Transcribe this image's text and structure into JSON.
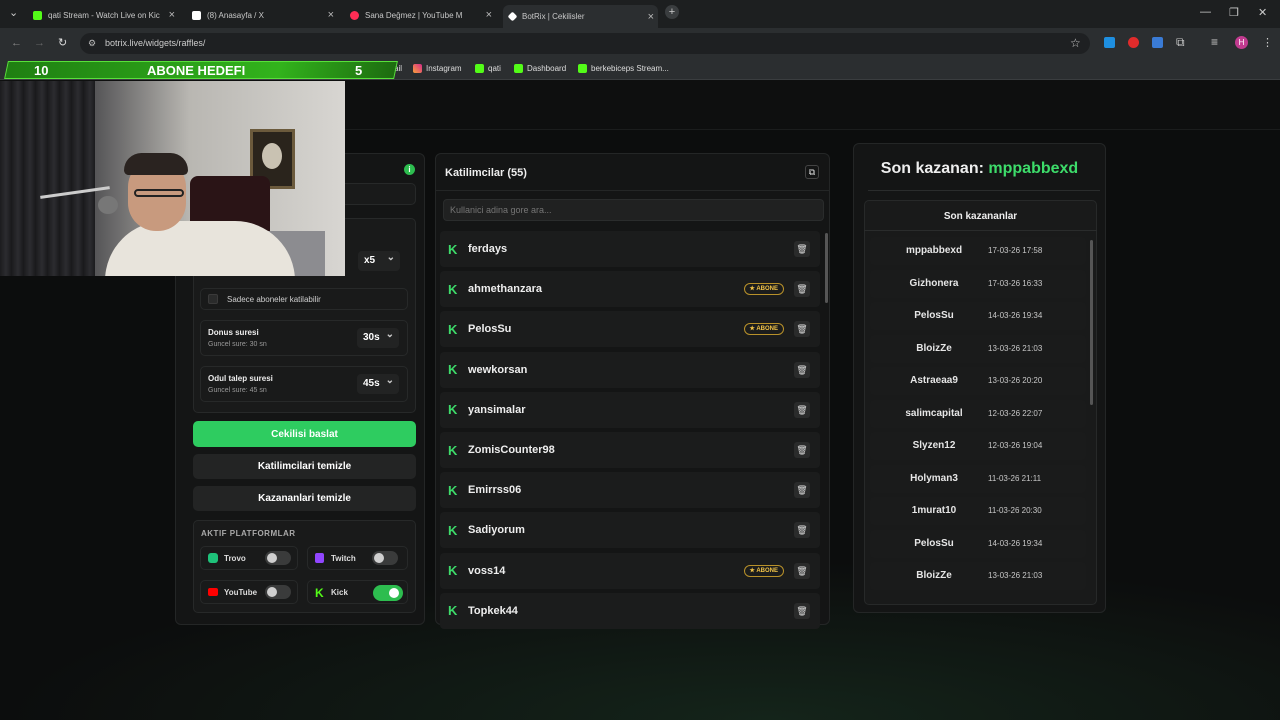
{
  "browser": {
    "tabs": [
      {
        "title": "qati Stream - Watch Live on Kic",
        "color": "#53fc18"
      },
      {
        "title": "(8) Anasayfa / X",
        "color": "#ffffff"
      },
      {
        "title": "Sana Değmez | YouTube M",
        "color": "#ff2d55"
      },
      {
        "title": "BotRix | Cekilisler",
        "color": "#ffffff"
      }
    ],
    "url": "botrix.live/widgets/raffles/",
    "bookmarks": [
      "Instagram",
      "qati",
      "Dashboard",
      "berkebiceps Stream..."
    ],
    "bookmark_partial": "ail"
  },
  "overlay": {
    "goal_left": "10",
    "goal_title": "ABONE HEDEFI",
    "goal_right": "5"
  },
  "settings": {
    "multiplier": "x5",
    "subs_only": "Sadece aboneler katilabilir",
    "spin_label": "Donus suresi",
    "spin_sub": "Guncel sure: 30 sn",
    "spin_value": "30s",
    "claim_label": "Odul talep suresi",
    "claim_sub": "Guncel sure: 45 sn",
    "claim_value": "45s",
    "start": "Cekilisi baslat",
    "clear_participants": "Katilimcilari temizle",
    "clear_winners": "Kazananlari temizle",
    "platforms_title": "AKTIF PLATFORMLAR",
    "platforms": [
      {
        "name": "Trovo",
        "on": false
      },
      {
        "name": "Twitch",
        "on": false
      },
      {
        "name": "YouTube",
        "on": false
      },
      {
        "name": "Kick",
        "on": true
      }
    ]
  },
  "participants": {
    "title": "Katilimcilar (55)",
    "search_placeholder": "Kullanici adina gore ara...",
    "badge": "ABONE",
    "rows": [
      {
        "name": "ferdays",
        "sub": false
      },
      {
        "name": "ahmethanzara",
        "sub": true
      },
      {
        "name": "PelosSu",
        "sub": true
      },
      {
        "name": "wewkorsan",
        "sub": false
      },
      {
        "name": "yansimalar",
        "sub": false
      },
      {
        "name": "ZomisCounter98",
        "sub": false
      },
      {
        "name": "Emirrss06",
        "sub": false
      },
      {
        "name": "Sadiyorum",
        "sub": false
      },
      {
        "name": "voss14",
        "sub": true
      },
      {
        "name": "Topkek44",
        "sub": false
      }
    ]
  },
  "winners": {
    "last_label": "Son kazanan:",
    "last_name": "mppabbexd",
    "list_title": "Son kazananlar",
    "rows": [
      {
        "name": "mppabbexd",
        "date": "17-03-26 17:58"
      },
      {
        "name": "Gizhonera",
        "date": "17-03-26 16:33"
      },
      {
        "name": "PelosSu",
        "date": "14-03-26 19:34"
      },
      {
        "name": "BloizZe",
        "date": "13-03-26 21:03"
      },
      {
        "name": "Astraeaa9",
        "date": "13-03-26 20:20"
      },
      {
        "name": "salimcapital",
        "date": "12-03-26 22:07"
      },
      {
        "name": "Slyzen12",
        "date": "12-03-26 19:04"
      },
      {
        "name": "Holyman3",
        "date": "11-03-26 21:11"
      },
      {
        "name": "1murat10",
        "date": "11-03-26 20:30"
      },
      {
        "name": "PelosSu",
        "date": "14-03-26 19:34"
      },
      {
        "name": "BloizZe",
        "date": "13-03-26 21:03"
      }
    ]
  },
  "colors": {
    "accent": "#3ddc6a",
    "kick": "#53fc18",
    "badge": "#f2c448"
  }
}
